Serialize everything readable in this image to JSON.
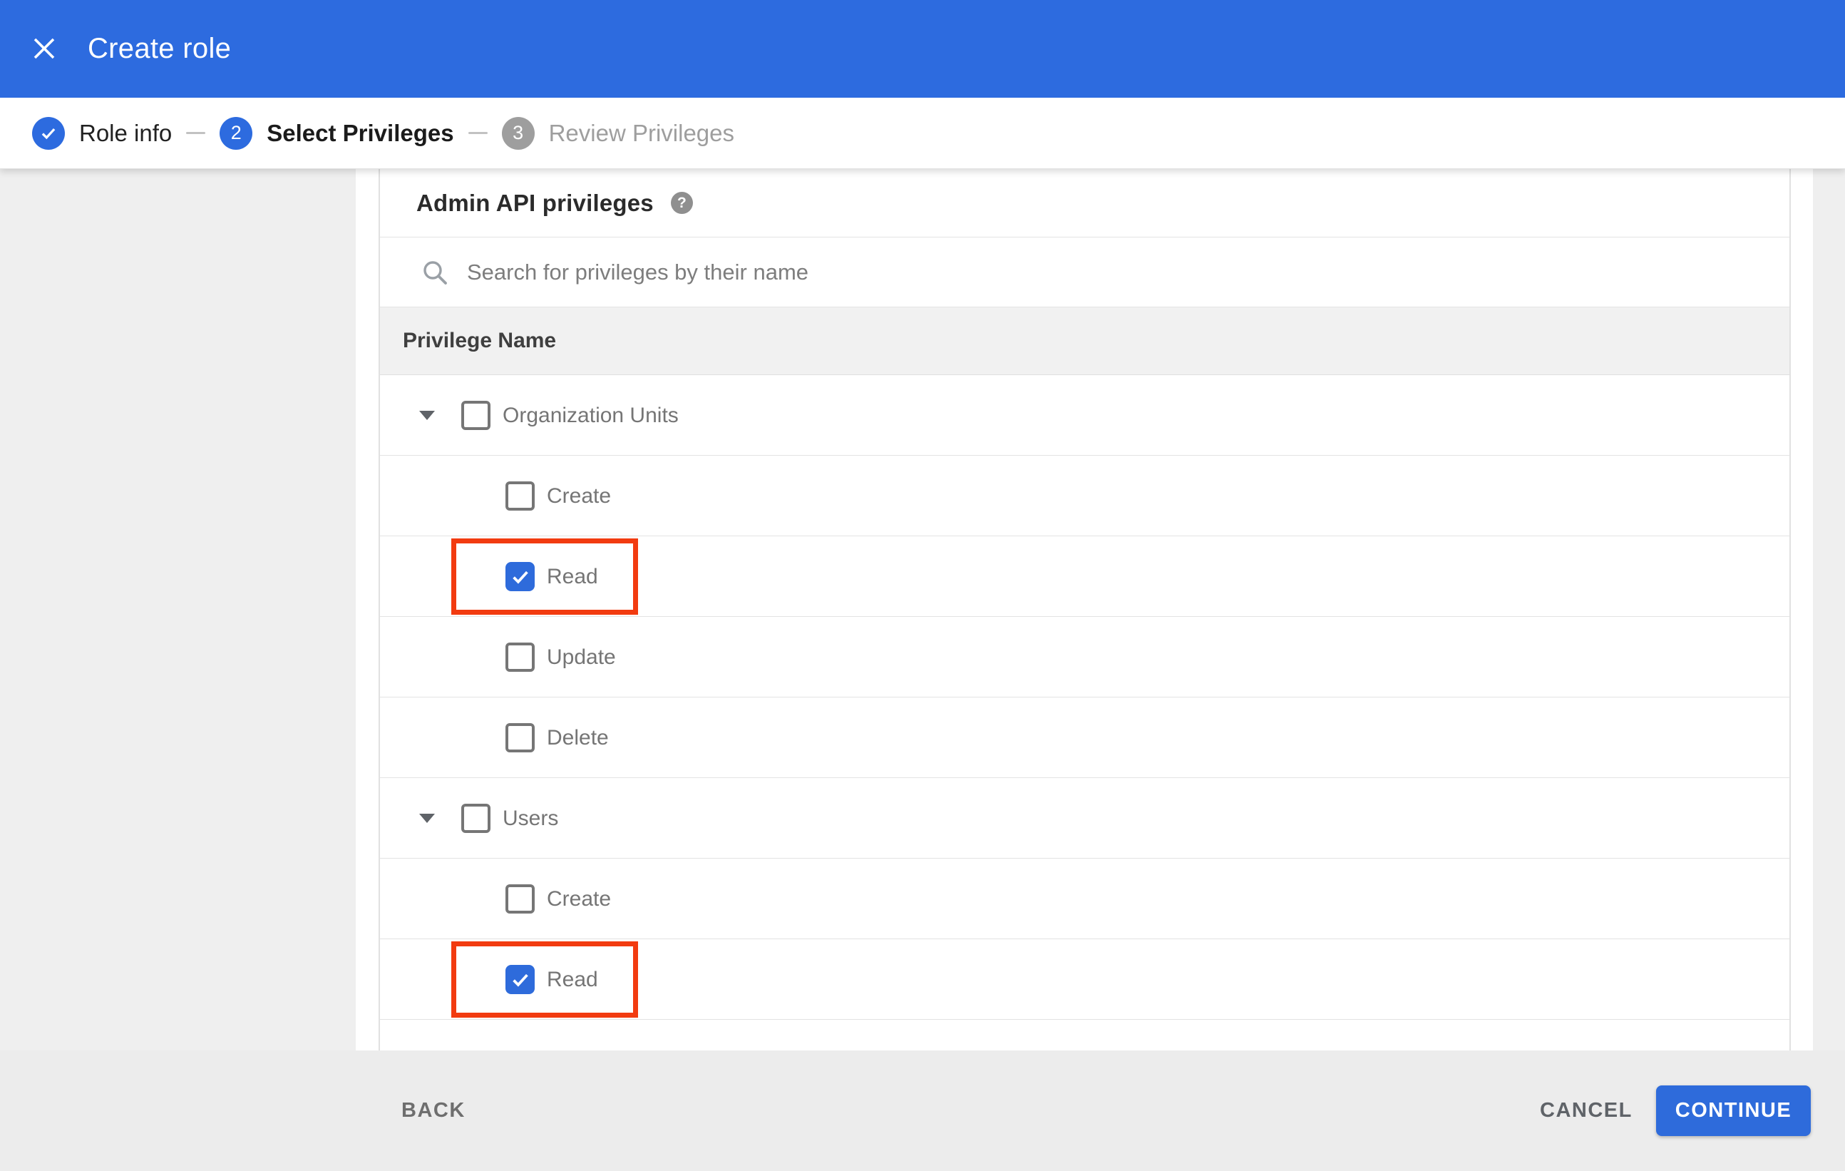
{
  "appbar": {
    "title": "Create role",
    "close_icon": "✕"
  },
  "stepper": {
    "steps": [
      {
        "number": "1",
        "label": "Role info",
        "state": "completed"
      },
      {
        "number": "2",
        "label": "Select Privileges",
        "state": "active"
      },
      {
        "number": "3",
        "label": "Review Privileges",
        "state": "upcoming"
      }
    ]
  },
  "panel": {
    "title": "Admin API privileges",
    "help_icon": "?",
    "search": {
      "placeholder": "Search for privileges by their name",
      "value": "",
      "icon": "magnifier"
    },
    "table": {
      "column_header": "Privilege Name"
    },
    "privileges": [
      {
        "label": "Organization Units",
        "level": 0,
        "expanded": true,
        "checked": false,
        "annotated": false
      },
      {
        "label": "Create",
        "level": 1,
        "expanded": null,
        "checked": false,
        "annotated": false
      },
      {
        "label": "Read",
        "level": 1,
        "expanded": null,
        "checked": true,
        "annotated": true
      },
      {
        "label": "Update",
        "level": 1,
        "expanded": null,
        "checked": false,
        "annotated": false
      },
      {
        "label": "Delete",
        "level": 1,
        "expanded": null,
        "checked": false,
        "annotated": false
      },
      {
        "label": "Users",
        "level": 0,
        "expanded": true,
        "checked": false,
        "annotated": false
      },
      {
        "label": "Create",
        "level": 1,
        "expanded": null,
        "checked": false,
        "annotated": false
      },
      {
        "label": "Read",
        "level": 1,
        "expanded": null,
        "checked": true,
        "annotated": true
      }
    ]
  },
  "footer": {
    "back": "BACK",
    "cancel": "CANCEL",
    "continue": "CONTINUE"
  },
  "colors": {
    "accent_blue": "#2d6bdf",
    "checkbox_checked_blue": "#2e6bdb",
    "annotation_red": "#f23b10",
    "page_background": "#efefef",
    "footer_background": "#ececec",
    "table_header_background": "#f1f1f1",
    "divider": "#e3e3e3",
    "row_label_gray": "#757575",
    "inactive_step_gray": "#9e9e9e"
  }
}
